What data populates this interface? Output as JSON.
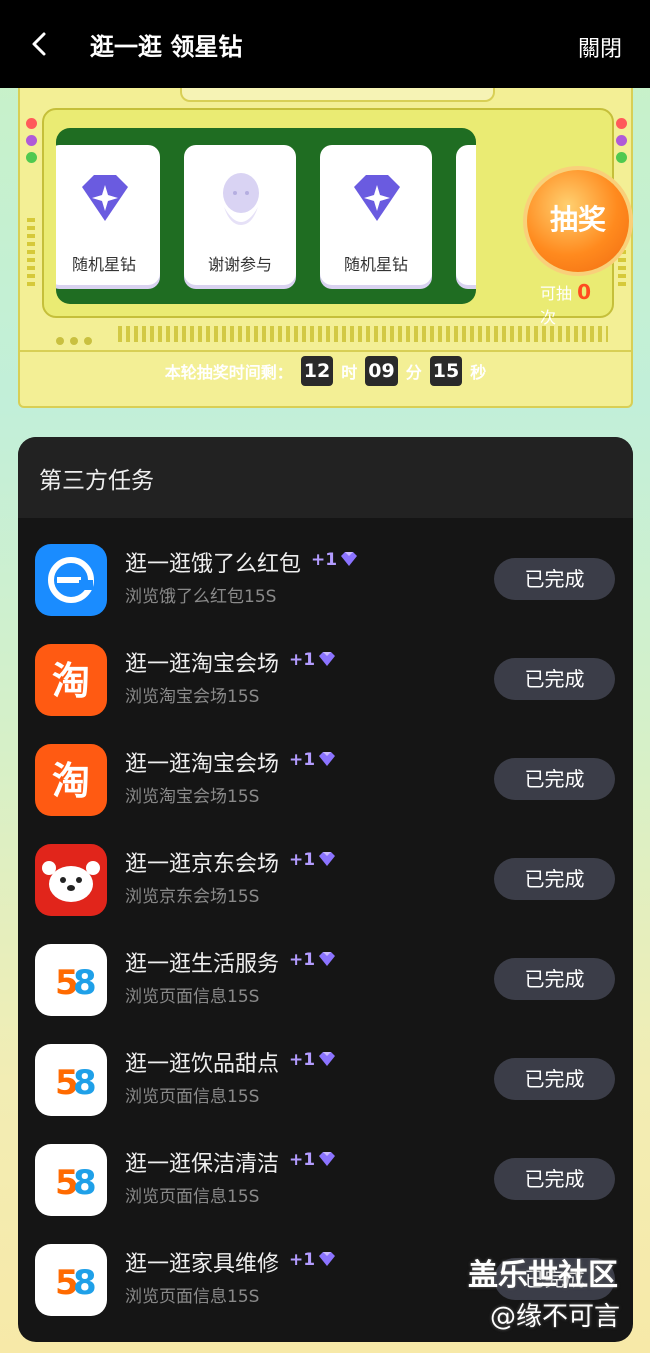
{
  "header": {
    "title": "逛一逛 领星钻",
    "close_label": "關閉"
  },
  "machine": {
    "reels": [
      {
        "label": "随机星钻",
        "icon": "diamond-icon"
      },
      {
        "label": "谢谢参与",
        "icon": "character-icon"
      },
      {
        "label": "随机星钻",
        "icon": "diamond-icon"
      }
    ],
    "draw_button_label": "抽奖",
    "draw_count_prefix": "可抽",
    "draw_count_value": "0",
    "draw_count_suffix": "次",
    "timer_label": "本轮抽奖时间剩：",
    "timer_hours": "12",
    "timer_hours_unit": "时",
    "timer_minutes": "09",
    "timer_minutes_unit": "分",
    "timer_seconds": "15",
    "timer_seconds_unit": "秒"
  },
  "tasks_panel": {
    "title": "第三方任务",
    "tasks": [
      {
        "title": "逛一逛饿了么红包",
        "reward": "+1",
        "sub": "浏览饿了么红包15S",
        "button": "已完成",
        "icon": "eleme-icon"
      },
      {
        "title": "逛一逛淘宝会场",
        "reward": "+1",
        "sub": "浏览淘宝会场15S",
        "button": "已完成",
        "icon": "taobao-icon"
      },
      {
        "title": "逛一逛淘宝会场",
        "reward": "+1",
        "sub": "浏览淘宝会场15S",
        "button": "已完成",
        "icon": "taobao-icon"
      },
      {
        "title": "逛一逛京东会场",
        "reward": "+1",
        "sub": "浏览京东会场15S",
        "button": "已完成",
        "icon": "jd-icon"
      },
      {
        "title": "逛一逛生活服务",
        "reward": "+1",
        "sub": "浏览页面信息15S",
        "button": "已完成",
        "icon": "58-icon"
      },
      {
        "title": "逛一逛饮品甜点",
        "reward": "+1",
        "sub": "浏览页面信息15S",
        "button": "已完成",
        "icon": "58-icon"
      },
      {
        "title": "逛一逛保洁清洁",
        "reward": "+1",
        "sub": "浏览页面信息15S",
        "button": "已完成",
        "icon": "58-icon"
      },
      {
        "title": "逛一逛家具维修",
        "reward": "+1",
        "sub": "浏览页面信息15S",
        "button": "已完成",
        "icon": "58-icon"
      }
    ]
  },
  "watermark": {
    "line1": "盖乐世社区",
    "line2": "@缘不可言"
  },
  "colors": {
    "accent_orange": "#ff8a1e",
    "reward_purple": "#b39cff",
    "panel_bg": "#151515",
    "reel_green": "#1f6d22"
  }
}
